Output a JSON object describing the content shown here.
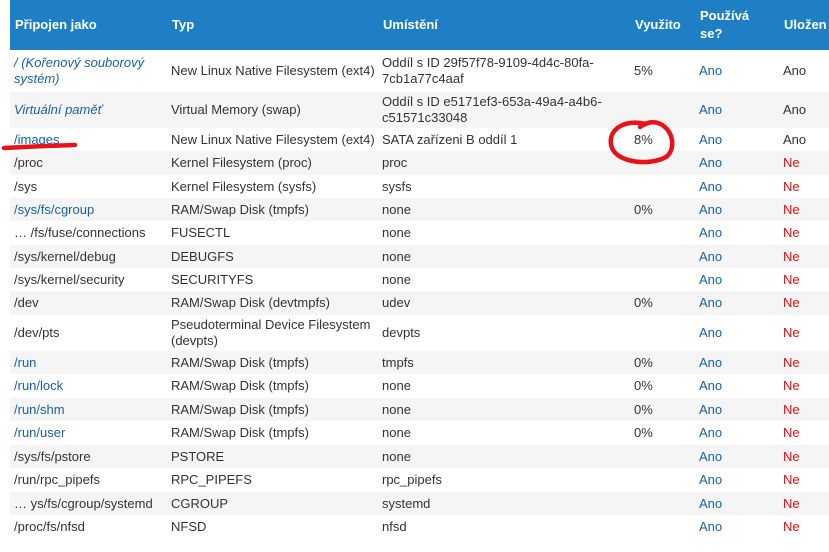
{
  "headers": {
    "mounted_as": "Připojen jako",
    "type": "Typ",
    "location": "Umístění",
    "usage": "Využito",
    "in_use": "Používá se?",
    "saved": "Uložen"
  },
  "rows": [
    {
      "mount": "/ (Kořenový souborový systém)",
      "type": "New Linux Native Filesystem (ext4)",
      "location": "Oddíl s ID 29f57f78-9109-4d4c-80fa-7cb1a77c4aaf",
      "usage": "5%",
      "in_use": "Ano",
      "saved": "Ano",
      "link": true,
      "italic": true
    },
    {
      "mount": "Virtuální paměť",
      "type": "Virtual Memory (swap)",
      "location": "Oddíl s ID e5171ef3-653a-49a4-a4b6-c51571c33048",
      "usage": "",
      "in_use": "Ano",
      "saved": "Ano",
      "link": true,
      "italic": true
    },
    {
      "mount": "/images",
      "type": "New Linux Native Filesystem (ext4)",
      "location": "SATA zařízeni B oddíl 1",
      "usage": "8%",
      "in_use": "Ano",
      "saved": "Ano",
      "link": true,
      "italic": false
    },
    {
      "mount": "/proc",
      "type": "Kernel Filesystem (proc)",
      "location": "proc",
      "usage": "",
      "in_use": "Ano",
      "saved": "Ne",
      "link": false,
      "italic": false
    },
    {
      "mount": "/sys",
      "type": "Kernel Filesystem (sysfs)",
      "location": "sysfs",
      "usage": "",
      "in_use": "Ano",
      "saved": "Ne",
      "link": false,
      "italic": false
    },
    {
      "mount": "/sys/fs/cgroup",
      "type": "RAM/Swap Disk (tmpfs)",
      "location": "none",
      "usage": "0%",
      "in_use": "Ano",
      "saved": "Ne",
      "link": true,
      "italic": false
    },
    {
      "mount": "… /fs/fuse/connections",
      "type": "FUSECTL",
      "location": "none",
      "usage": "",
      "in_use": "Ano",
      "saved": "Ne",
      "link": false,
      "italic": false
    },
    {
      "mount": "/sys/kernel/debug",
      "type": "DEBUGFS",
      "location": "none",
      "usage": "",
      "in_use": "Ano",
      "saved": "Ne",
      "link": false,
      "italic": false
    },
    {
      "mount": "/sys/kernel/security",
      "type": "SECURITYFS",
      "location": "none",
      "usage": "",
      "in_use": "Ano",
      "saved": "Ne",
      "link": false,
      "italic": false
    },
    {
      "mount": "/dev",
      "type": "RAM/Swap Disk (devtmpfs)",
      "location": "udev",
      "usage": "0%",
      "in_use": "Ano",
      "saved": "Ne",
      "link": false,
      "italic": false
    },
    {
      "mount": "/dev/pts",
      "type": "Pseudoterminal Device Filesystem (devpts)",
      "location": "devpts",
      "usage": "",
      "in_use": "Ano",
      "saved": "Ne",
      "link": false,
      "italic": false
    },
    {
      "mount": "/run",
      "type": "RAM/Swap Disk (tmpfs)",
      "location": "tmpfs",
      "usage": "0%",
      "in_use": "Ano",
      "saved": "Ne",
      "link": true,
      "italic": false
    },
    {
      "mount": "/run/lock",
      "type": "RAM/Swap Disk (tmpfs)",
      "location": "none",
      "usage": "0%",
      "in_use": "Ano",
      "saved": "Ne",
      "link": true,
      "italic": false
    },
    {
      "mount": "/run/shm",
      "type": "RAM/Swap Disk (tmpfs)",
      "location": "none",
      "usage": "0%",
      "in_use": "Ano",
      "saved": "Ne",
      "link": true,
      "italic": false
    },
    {
      "mount": "/run/user",
      "type": "RAM/Swap Disk (tmpfs)",
      "location": "none",
      "usage": "0%",
      "in_use": "Ano",
      "saved": "Ne",
      "link": true,
      "italic": false
    },
    {
      "mount": "/sys/fs/pstore",
      "type": "PSTORE",
      "location": "none",
      "usage": "",
      "in_use": "Ano",
      "saved": "Ne",
      "link": false,
      "italic": false
    },
    {
      "mount": "/run/rpc_pipefs",
      "type": "RPC_PIPEFS",
      "location": "rpc_pipefs",
      "usage": "",
      "in_use": "Ano",
      "saved": "Ne",
      "link": false,
      "italic": false
    },
    {
      "mount": "… ys/fs/cgroup/systemd",
      "type": "CGROUP",
      "location": "systemd",
      "usage": "",
      "in_use": "Ano",
      "saved": "Ne",
      "link": false,
      "italic": false
    },
    {
      "mount": "/proc/fs/nfsd",
      "type": "NFSD",
      "location": "nfsd",
      "usage": "",
      "in_use": "Ano",
      "saved": "Ne",
      "link": false,
      "italic": false
    }
  ],
  "colors": {
    "header_bg": "#1f7fc4",
    "link": "#1a5fa8",
    "no": "#dd1111",
    "annotation": "#e8121a"
  },
  "annotations": {
    "underline_target": "/images",
    "circle_target": "8%"
  }
}
